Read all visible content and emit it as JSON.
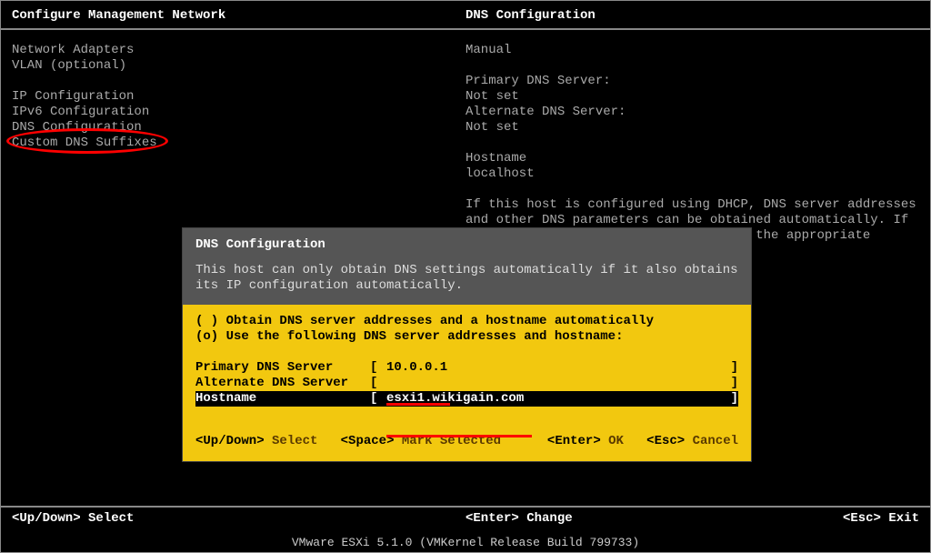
{
  "header": {
    "left": "Configure Management Network",
    "right": "DNS Configuration"
  },
  "menu": {
    "items": [
      "Network Adapters",
      "VLAN (optional)",
      "",
      "IP Configuration",
      "IPv6 Configuration",
      "DNS Configuration",
      "Custom DNS Suffixes"
    ]
  },
  "info": {
    "manual": "Manual",
    "primary_label": "Primary DNS Server:",
    "primary_value": "Not set",
    "alternate_label": "Alternate DNS Server:",
    "alternate_value": "Not set",
    "hostname_label": "Hostname",
    "hostname_value": "localhost",
    "paragraph": "If this host is configured using DHCP, DNS server addresses and other DNS parameters can be obtained automatically. If it is not, ask your administrator for the appropriate settings."
  },
  "dialog": {
    "title": "DNS Configuration",
    "subtitle": "This host can only obtain DNS settings automatically if it also obtains its IP configuration automatically.",
    "option_auto": "( ) Obtain DNS server addresses and a hostname automatically",
    "option_manual": "(o) Use the following DNS server addresses and hostname:",
    "fields": {
      "primary_label": "Primary DNS Server",
      "primary_value": "10.0.0.1",
      "alternate_label": "Alternate DNS Server",
      "alternate_value": "",
      "hostname_label": "Hostname",
      "hostname_value": "esxi1.wikigain.com"
    },
    "footer": {
      "updown": "<Up/Down>",
      "select": " Select",
      "space": "<Space>",
      "mark": " Mark Selected",
      "enter": "<Enter>",
      "ok": " OK",
      "esc": "<Esc>",
      "cancel": " Cancel"
    }
  },
  "footer": {
    "updown": "<Up/Down>",
    "select": " Select",
    "enter": "<Enter>",
    "change": " Change",
    "esc": "<Esc>",
    "exit": " Exit"
  },
  "brand": "VMware ESXi 5.1.0 (VMKernel Release Build 799733)"
}
